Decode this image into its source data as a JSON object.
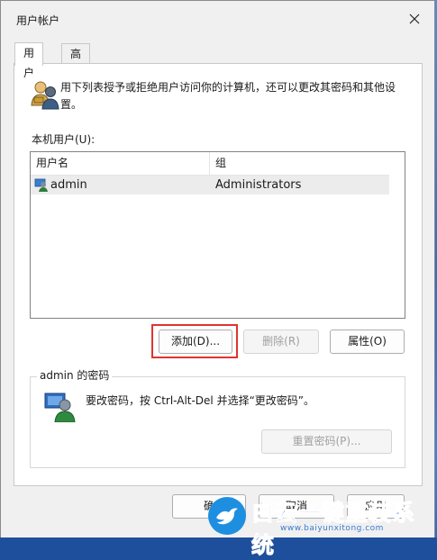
{
  "window": {
    "title": "用户帐户",
    "tabs": [
      {
        "label": "用户",
        "active": true
      },
      {
        "label": "高级",
        "active": false
      }
    ]
  },
  "main": {
    "description": "用下列表授予或拒绝用户访问你的计算机，还可以更改其密码和其他设置。",
    "users_label": "本机用户(U):",
    "columns": [
      "用户名",
      "组"
    ],
    "users": [
      {
        "name": "admin",
        "group": "Administrators"
      }
    ],
    "buttons": {
      "add": "添加(D)...",
      "remove": "删除(R)",
      "properties": "属性(O)"
    }
  },
  "password": {
    "group_title": "admin 的密码",
    "hint": "要改密码，按 Ctrl-Alt-Del 并选择“更改密码”。",
    "reset_button": "重置密码(P)..."
  },
  "footer": {
    "ok": "确",
    "cancel": "取消",
    "apply": "应用"
  },
  "watermark": {
    "text": "白云一键重装系统",
    "url": "www.baiyunxitong.com"
  },
  "colors": {
    "highlight": "#e0342f",
    "watermark_blue": "#1b73d1"
  }
}
